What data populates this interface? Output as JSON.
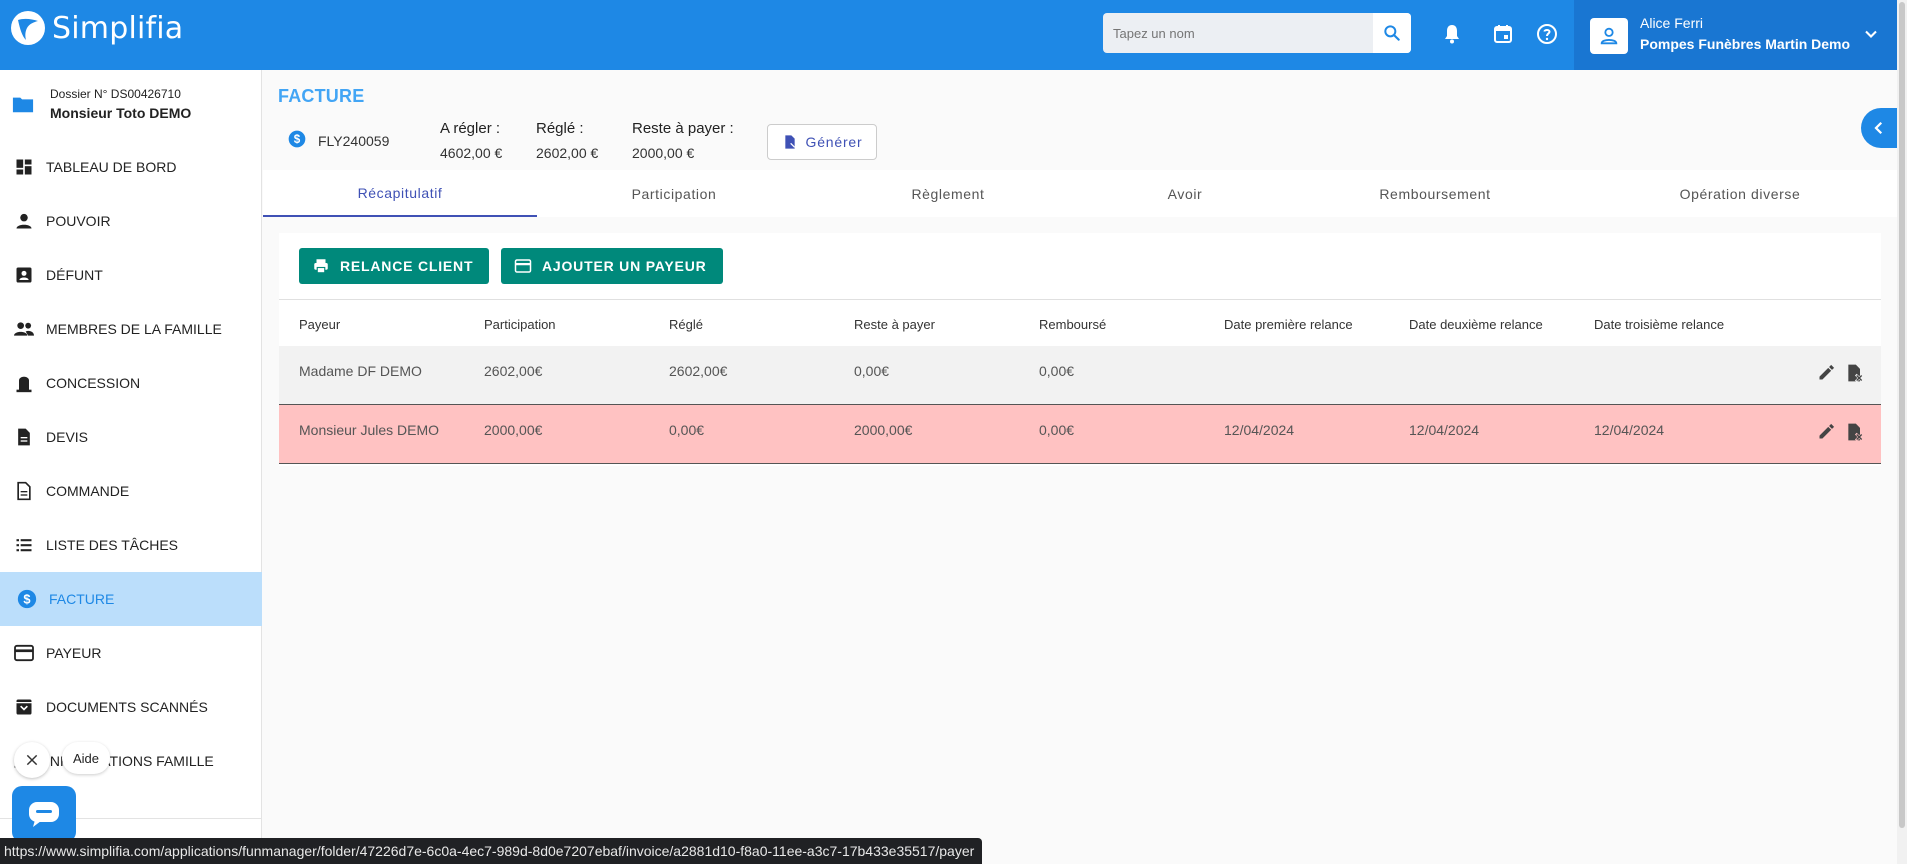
{
  "app": {
    "name": "Simplifia"
  },
  "search": {
    "placeholder": "Tapez un nom"
  },
  "user": {
    "name": "Alice Ferri",
    "organization": "Pompes Funèbres Martin Demo"
  },
  "dossier": {
    "number": "Dossier N° DS00426710",
    "name": "Monsieur Toto DEMO"
  },
  "sidebar": {
    "items": [
      {
        "label": "TABLEAU DE BORD",
        "icon": "dashboard-icon"
      },
      {
        "label": "POUVOIR",
        "icon": "person-icon"
      },
      {
        "label": "DÉFUNT",
        "icon": "id-card-icon"
      },
      {
        "label": "MEMBRES DE LA FAMILLE",
        "icon": "group-icon"
      },
      {
        "label": "CONCESSION",
        "icon": "tombstone-icon"
      },
      {
        "label": "DEVIS",
        "icon": "document-icon"
      },
      {
        "label": "COMMANDE",
        "icon": "document-icon"
      },
      {
        "label": "LISTE DES TÂCHES",
        "icon": "list-icon"
      },
      {
        "label": "FACTURE",
        "icon": "dollar-icon",
        "active": true
      },
      {
        "label": "PAYEUR",
        "icon": "credit-card-icon"
      },
      {
        "label": "DOCUMENTS SCANNÉS",
        "icon": "archive-icon"
      },
      {
        "label": "INFORMATIONS FAMILLE",
        "icon": "people-icon"
      }
    ]
  },
  "invoice": {
    "title": "FACTURE",
    "number": "FLY240059",
    "a_regler_label": "A régler :",
    "a_regler_value": "4602,00 €",
    "regle_label": "Réglé :",
    "regle_value": "2602,00 €",
    "reste_label": "Reste à payer :",
    "reste_value": "2000,00 €",
    "generate_label": "Générer"
  },
  "tabs": [
    {
      "label": "Récapitulatif",
      "active": true
    },
    {
      "label": "Participation"
    },
    {
      "label": "Règlement"
    },
    {
      "label": "Avoir"
    },
    {
      "label": "Remboursement"
    },
    {
      "label": "Opération diverse"
    }
  ],
  "actions": {
    "relance_label": "RELANCE CLIENT",
    "add_payer_label": "AJOUTER UN PAYEUR"
  },
  "table": {
    "headers": [
      "Payeur",
      "Participation",
      "Réglé",
      "Reste à payer",
      "Remboursé",
      "Date première relance",
      "Date deuxième relance",
      "Date troisième relance"
    ],
    "rows": [
      [
        "Madame DF DEMO",
        "2602,00€",
        "2602,00€",
        "0,00€",
        "0,00€",
        "",
        "",
        ""
      ],
      [
        "Monsieur Jules DEMO",
        "2000,00€",
        "0,00€",
        "2000,00€",
        "0,00€",
        "12/04/2024",
        "12/04/2024",
        "12/04/2024"
      ]
    ]
  },
  "help": {
    "label": "Aide"
  },
  "status_url": "https://www.simplifia.com/applications/funmanager/folder/47226d7e-6c0a-4ec7-989d-8d0e7207ebaf/invoice/a2881d10-f8a0-11ee-a3c7-17b433e35517/payer",
  "colors": {
    "primary": "#1e88e5",
    "header_dark": "#1976d2",
    "green": "#00897b",
    "row_alert": "#ffc2c2",
    "active_nav": "#bbdefb",
    "tab_active": "#3f51b5"
  }
}
